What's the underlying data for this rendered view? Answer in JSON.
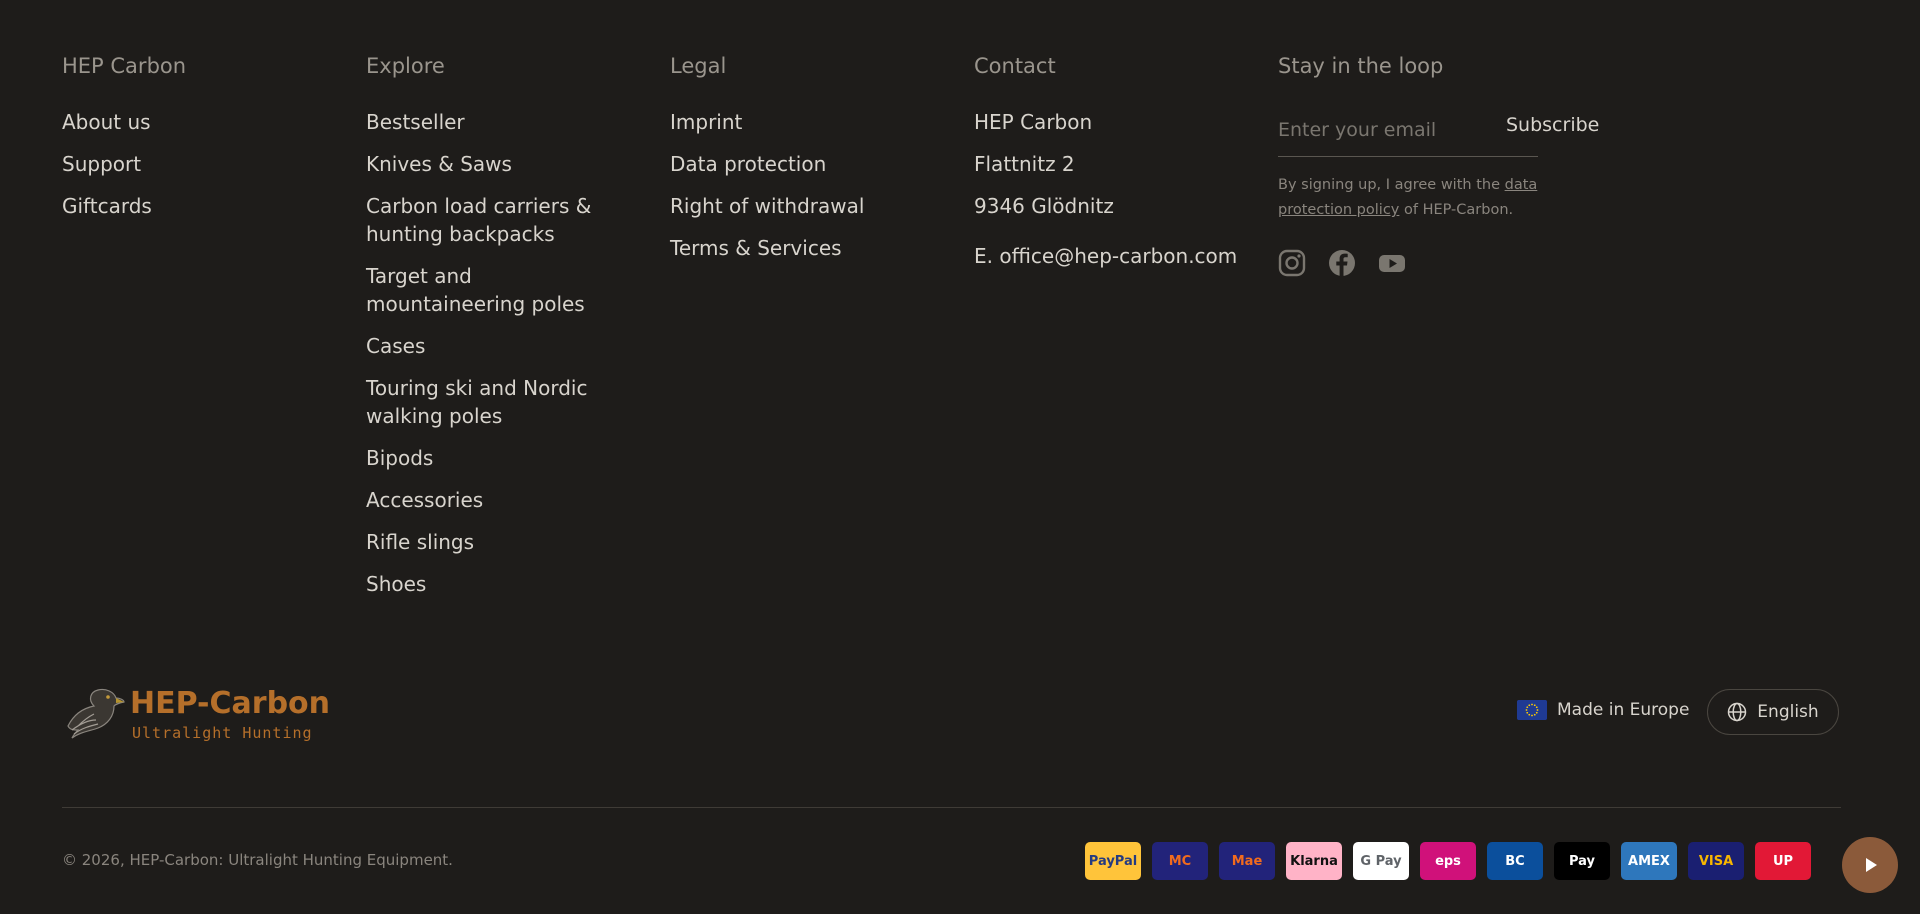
{
  "columns": {
    "brand": {
      "heading": "HEP Carbon",
      "links": [
        "About us",
        "Support",
        "Giftcards"
      ]
    },
    "explore": {
      "heading": "Explore",
      "links": [
        "Bestseller",
        "Knives & Saws",
        "Carbon load carriers & hunting backpacks",
        "Target and mountaineering poles",
        "Cases",
        "Touring ski and Nordic walking poles",
        "Bipods",
        "Accessories",
        "Rifle slings",
        "Shoes"
      ]
    },
    "legal": {
      "heading": "Legal",
      "links": [
        "Imprint",
        "Data protection",
        "Right of withdrawal",
        "Terms & Services"
      ]
    },
    "contact": {
      "heading": "Contact",
      "lines": [
        "HEP Carbon",
        "Flattnitz 2",
        "9346 Glödnitz"
      ],
      "email": "E. office@hep-carbon.com"
    },
    "newsletter": {
      "heading": "Stay in the loop",
      "placeholder": "Enter your email",
      "subscribe": "Subscribe",
      "consent_pre": "By signing up, I agree with the ",
      "consent_link": "data protection policy",
      "consent_post": " of HEP-Carbon."
    }
  },
  "socials": [
    "instagram-icon",
    "facebook-icon",
    "youtube-icon"
  ],
  "logo": {
    "main": "HEP-Carbon",
    "sub": "Ultralight Hunting",
    "color": "#b56f2a"
  },
  "made_in": "Made in Europe",
  "language": "English",
  "copyright": "© 2026, HEP-Carbon: Ultralight Hunting Equipment.",
  "payments": [
    {
      "label": "PayPal",
      "bg": "#ffc43a",
      "fg": "#253b80"
    },
    {
      "label": "MC",
      "bg": "#22237a",
      "fg": "#f26b1d"
    },
    {
      "label": "Mae",
      "bg": "#22237a",
      "fg": "#f26b1d"
    },
    {
      "label": "Klarna",
      "bg": "#ffb3c7",
      "fg": "#111111"
    },
    {
      "label": "G Pay",
      "bg": "#ffffff",
      "fg": "#5f6368"
    },
    {
      "label": "eps",
      "bg": "#d0117a",
      "fg": "#ffffff"
    },
    {
      "label": "BC",
      "bg": "#0b4f9c",
      "fg": "#ffffff"
    },
    {
      "label": "Pay",
      "bg": "#000000",
      "fg": "#ffffff"
    },
    {
      "label": "AMEX",
      "bg": "#2e77bc",
      "fg": "#ffffff"
    },
    {
      "label": "VISA",
      "bg": "#1a1f71",
      "fg": "#f7b600"
    },
    {
      "label": "UP",
      "bg": "#e21836",
      "fg": "#ffffff"
    }
  ],
  "colors": {
    "background": "#1e1c1a",
    "accent": "#b56f2a",
    "play_button": "#8b5a3a"
  }
}
